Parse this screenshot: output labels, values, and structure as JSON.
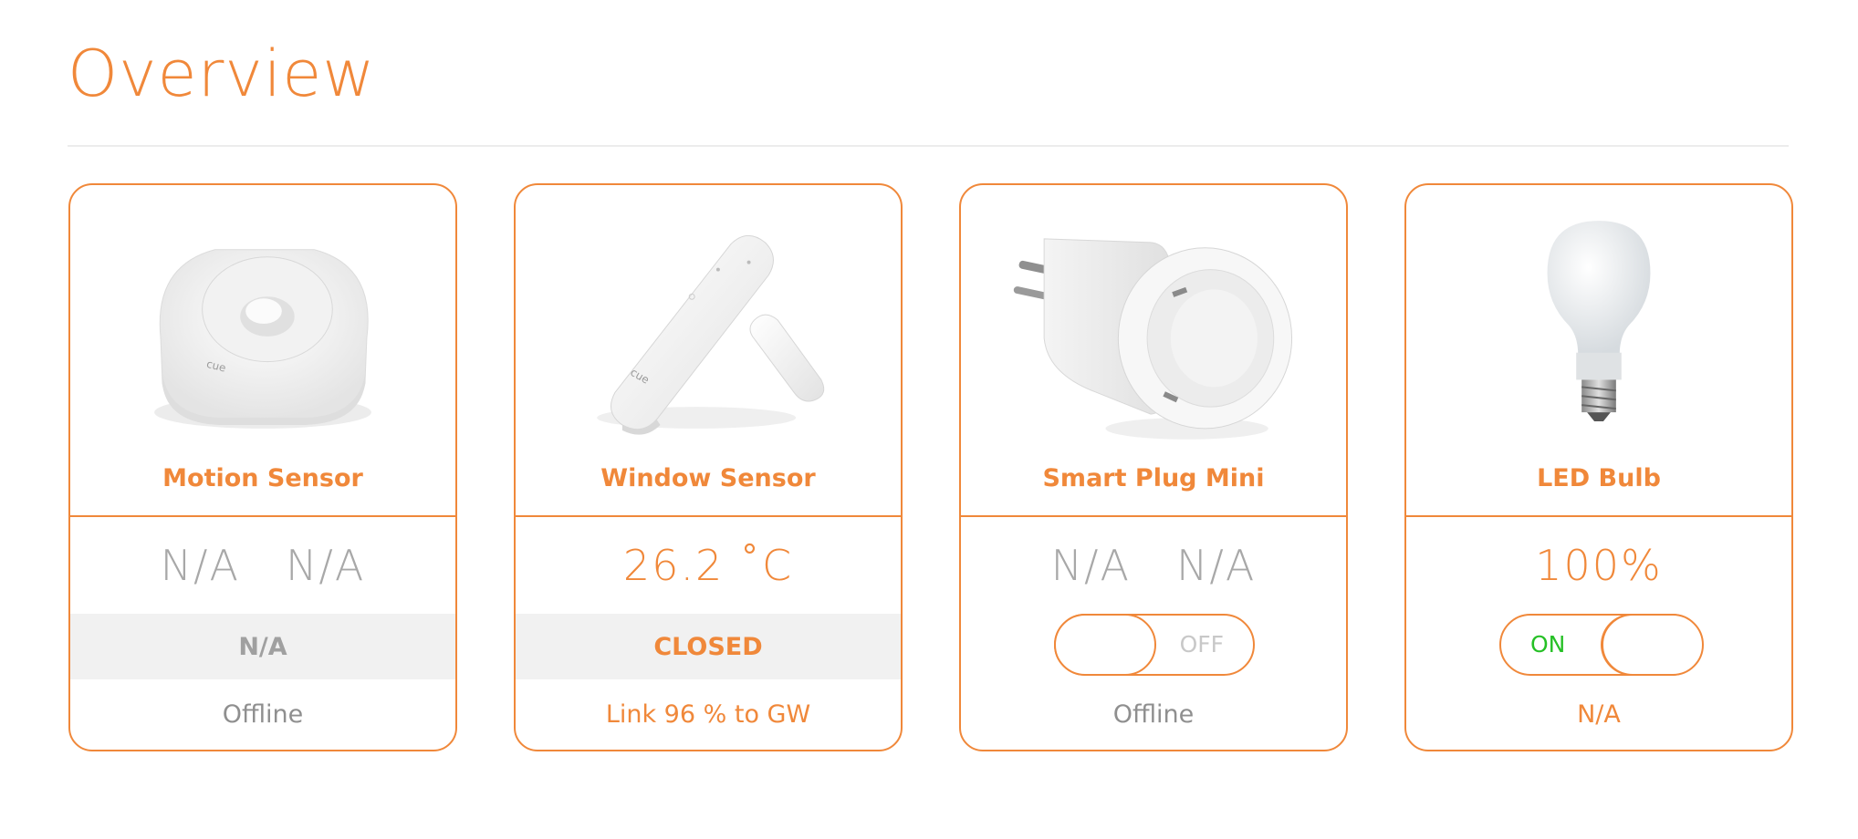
{
  "page": {
    "title": "Overview"
  },
  "colors": {
    "accent": "#f0883a",
    "muted": "#a8a8a8",
    "on": "#26c026",
    "band": "#f1f1f1"
  },
  "devices": [
    {
      "name": "Motion Sensor",
      "icon": "motion-sensor-image",
      "readings": [
        "N/A",
        "N/A"
      ],
      "state": "N/A",
      "footer": "Offline"
    },
    {
      "name": "Window Sensor",
      "icon": "window-sensor-image",
      "readings": [
        "26.2 ˚C"
      ],
      "state": "CLOSED",
      "footer": "Link 96 % to GW"
    },
    {
      "name": "Smart Plug Mini",
      "icon": "smart-plug-image",
      "readings": [
        "N/A",
        "N/A"
      ],
      "toggle": {
        "label": "OFF",
        "state": "off"
      },
      "footer": "Offline"
    },
    {
      "name": "LED Bulb",
      "icon": "led-bulb-image",
      "readings": [
        "100%"
      ],
      "toggle": {
        "label": "ON",
        "state": "on"
      },
      "footer": "N/A"
    }
  ]
}
